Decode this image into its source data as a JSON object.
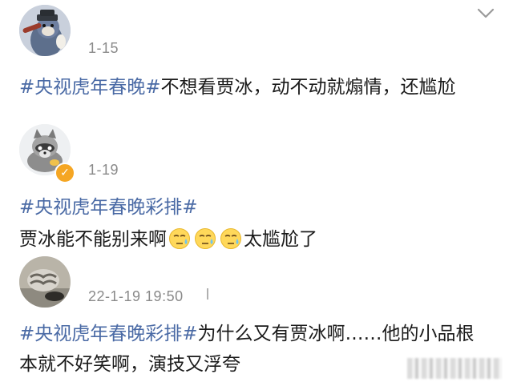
{
  "posts": [
    {
      "date": "1-15",
      "tag": "#央视虎年春晚#",
      "text": "不想看贾冰，动不动就煽情，还尴尬",
      "avatar": "cat-avatar"
    },
    {
      "date": "1-19",
      "tag": "#央视虎年春晚彩排#",
      "text_before": "贾冰能不能别来啊",
      "emoji_count": 3,
      "text_after": "太尴尬了",
      "avatar": "raccoon-avatar",
      "verified": true
    },
    {
      "date": "22-1-19 19:50",
      "tag": "#央视虎年春晚彩排#",
      "text": "为什么又有贾冰啊……他的小品根本就不好笑啊，演技又浮夸",
      "avatar": "cat-photo-avatar"
    }
  ],
  "icons": {
    "menu": "chevron-down-icon",
    "emoji": "sweat-face-emoji"
  },
  "colors": {
    "hashtag": "#4a6aa5",
    "date": "#8a8a8a",
    "verified": "#f5a623"
  }
}
